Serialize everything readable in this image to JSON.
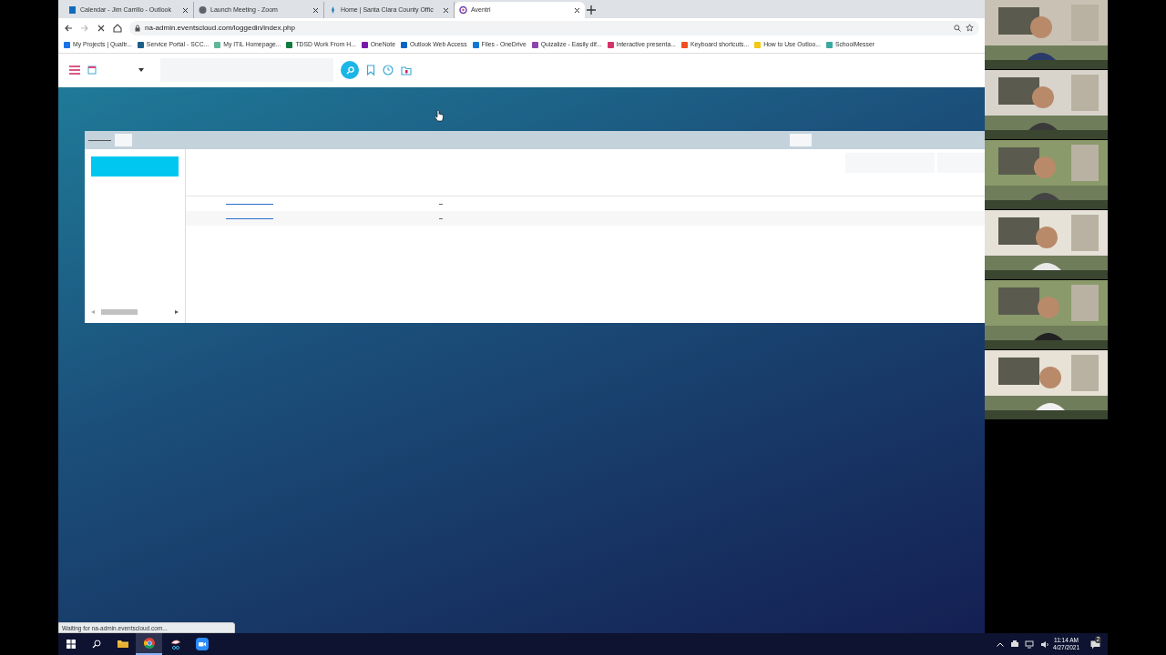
{
  "tabs": [
    {
      "title": "Calendar - Jim Carrillo - Outlook",
      "kind": "outlook",
      "selected": false
    },
    {
      "title": "Launch Meeting - Zoom",
      "kind": "globe",
      "selected": false
    },
    {
      "title": "Home | Santa Clara County Offic",
      "kind": "sccoe",
      "selected": false
    },
    {
      "title": "Aventri",
      "kind": "aventri",
      "selected": true
    }
  ],
  "address_bar": {
    "url": "na-admin.eventscloud.com/loggedin/index.php",
    "loading": true
  },
  "bookmarks": [
    {
      "label": "My Projects | Qualtr...",
      "color": "#1a73e8"
    },
    {
      "label": "Service Portal - SCC...",
      "color": "#1b5e8a"
    },
    {
      "label": "My ITIL Homepage...",
      "color": "#5fb89a"
    },
    {
      "label": "TDSD Work From H...",
      "color": "#107c41"
    },
    {
      "label": "OneNote",
      "color": "#7719aa"
    },
    {
      "label": "Outlook Web Access",
      "color": "#0a64c8"
    },
    {
      "label": "Files - OneDrive",
      "color": "#0f78d4"
    },
    {
      "label": "Quizalize - Easily dif...",
      "color": "#8e44ad"
    },
    {
      "label": "Interactive presenta...",
      "color": "#d6336c"
    },
    {
      "label": "Keyboard shortcuts...",
      "color": "#f25022"
    },
    {
      "label": "How to Use Outloo...",
      "color": "#f2c811"
    },
    {
      "label": "SchoolMesser",
      "color": "#3aa99f"
    }
  ],
  "status_bubble": "Waiting for na-admin.eventscloud.com...",
  "taskbar_apps": [
    {
      "kind": "files",
      "active": false
    },
    {
      "kind": "chrome",
      "active": true
    },
    {
      "kind": "snip",
      "active": false
    },
    {
      "kind": "zoom",
      "active": false
    }
  ],
  "clock": {
    "time": "11:14 AM",
    "date": "4/27/2021"
  },
  "notifications": "2"
}
